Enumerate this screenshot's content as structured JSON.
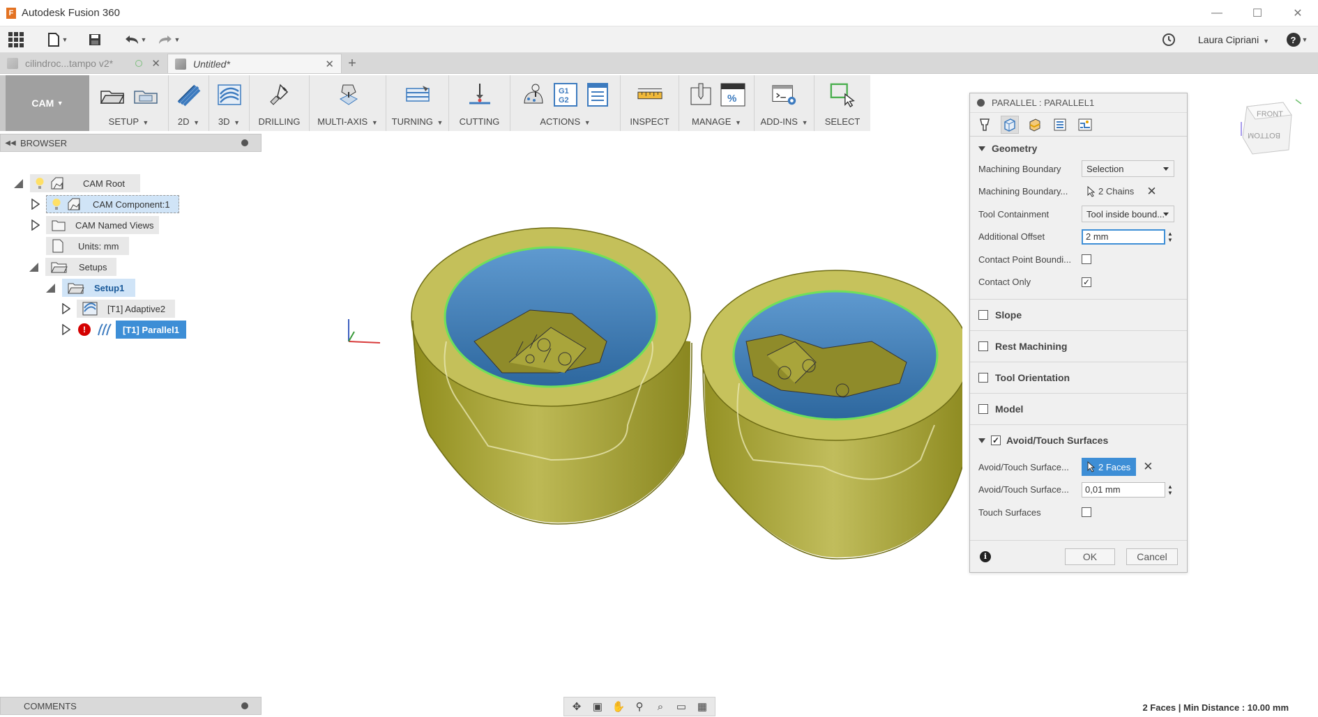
{
  "window": {
    "title": "Autodesk Fusion 360",
    "logo_letter": "F",
    "controls": {
      "minimize": "—",
      "maximize": "☐",
      "close": "✕"
    }
  },
  "qa": {
    "user": "Laura Cipriani",
    "help": "?"
  },
  "tabs": [
    {
      "label": "cilindroc...tampo v2*",
      "state": "inactive"
    },
    {
      "label": "Untitled*",
      "state": "active"
    }
  ],
  "toolbar": {
    "workspace": "CAM",
    "groups": [
      {
        "label": "SETUP",
        "dropdown": true
      },
      {
        "label": "2D",
        "dropdown": true
      },
      {
        "label": "3D",
        "dropdown": true
      },
      {
        "label": "DRILLING",
        "dropdown": false
      },
      {
        "label": "MULTI-AXIS",
        "dropdown": true
      },
      {
        "label": "TURNING",
        "dropdown": true
      },
      {
        "label": "CUTTING",
        "dropdown": false
      },
      {
        "label": "ACTIONS",
        "dropdown": true
      },
      {
        "label": "INSPECT",
        "dropdown": false
      },
      {
        "label": "MANAGE",
        "dropdown": true
      },
      {
        "label": "ADD-INS",
        "dropdown": true
      },
      {
        "label": "SELECT",
        "dropdown": false
      }
    ],
    "actions_g1g2": "G1\nG2"
  },
  "browser": {
    "title": "BROWSER",
    "nodes": {
      "root": "CAM Root",
      "component": "CAM Component:1",
      "named_views": "CAM Named Views",
      "units": "Units: mm",
      "setups": "Setups",
      "setup1": "Setup1",
      "adaptive": "[T1] Adaptive2",
      "parallel": "[T1] Parallel1"
    }
  },
  "comments": {
    "title": "COMMENTS"
  },
  "viewcube": {
    "front": "FRONT",
    "bottom": "BOTTOM"
  },
  "status": "2 Faces | Min Distance : 10.00 mm",
  "dialog": {
    "title": "PARALLEL : PARALLEL1",
    "geometry": {
      "heading": "Geometry",
      "machining_boundary_label": "Machining Boundary",
      "machining_boundary_value": "Selection",
      "machining_boundary_sel_label": "Machining Boundary...",
      "machining_boundary_sel_value": "2 Chains",
      "tool_containment_label": "Tool Containment",
      "tool_containment_value": "Tool inside bound...",
      "additional_offset_label": "Additional Offset",
      "additional_offset_value": "2 mm",
      "contact_point_label": "Contact Point Boundi...",
      "contact_point_checked": false,
      "contact_only_label": "Contact Only",
      "contact_only_checked": true
    },
    "sections": {
      "slope": "Slope",
      "rest": "Rest Machining",
      "orientation": "Tool Orientation",
      "model": "Model"
    },
    "avoid": {
      "heading": "Avoid/Touch Surfaces",
      "checked": true,
      "surfaces_label": "Avoid/Touch Surface...",
      "surfaces_value": "2 Faces",
      "offset_label": "Avoid/Touch Surface...",
      "offset_value": "0,01 mm",
      "touch_label": "Touch Surfaces",
      "touch_checked": false
    },
    "ok": "OK",
    "cancel": "Cancel",
    "info": "i"
  },
  "colors": {
    "accent": "#3d8ed6",
    "part_body": "#a8a632",
    "part_inner": "#3f7fb8",
    "edge_highlight": "#6fe05a"
  }
}
